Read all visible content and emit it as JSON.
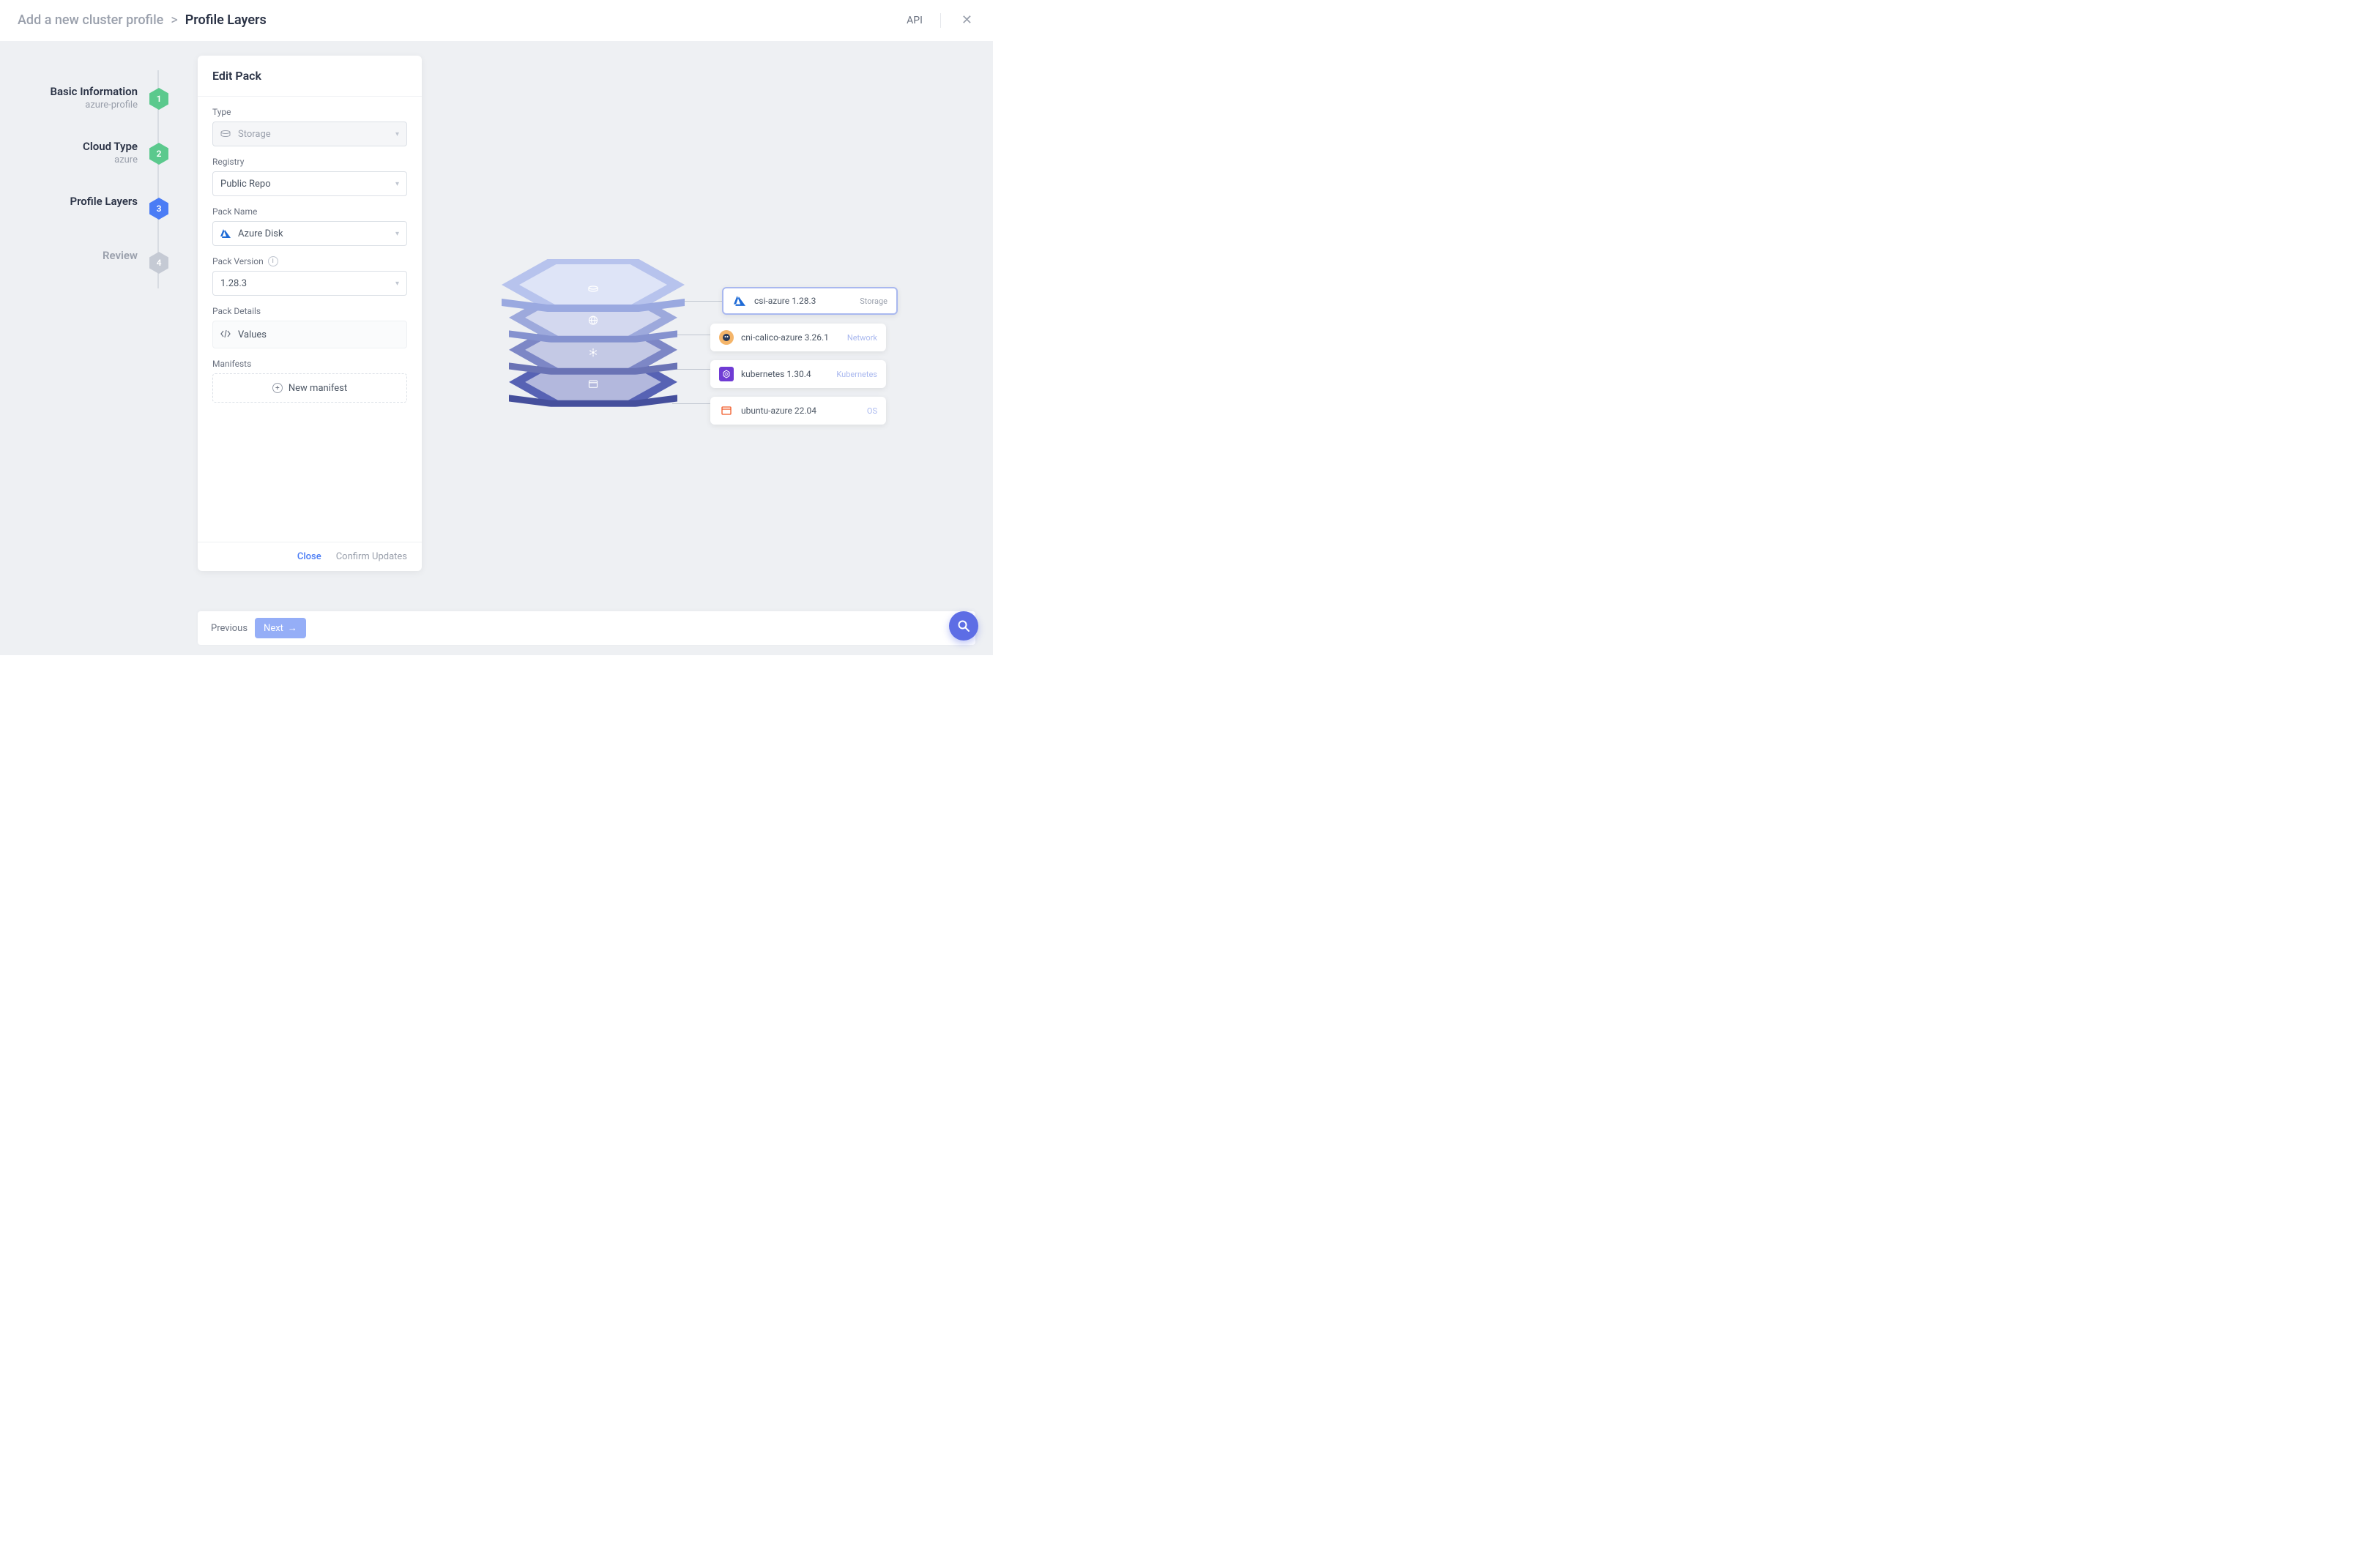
{
  "header": {
    "breadcrumb_prev": "Add a new cluster profile",
    "breadcrumb_sep": ">",
    "breadcrumb_current": "Profile Layers",
    "api_label": "API"
  },
  "steps": [
    {
      "num": "1",
      "title": "Basic Information",
      "sub": "azure-profile",
      "state": "done"
    },
    {
      "num": "2",
      "title": "Cloud Type",
      "sub": "azure",
      "state": "done"
    },
    {
      "num": "3",
      "title": "Profile Layers",
      "sub": "",
      "state": "active"
    },
    {
      "num": "4",
      "title": "Review",
      "sub": "",
      "state": "pending"
    }
  ],
  "panel": {
    "title": "Edit Pack",
    "fields": {
      "type": {
        "label": "Type",
        "value": "Storage"
      },
      "registry": {
        "label": "Registry",
        "value": "Public Repo"
      },
      "pack_name": {
        "label": "Pack Name",
        "value": "Azure Disk"
      },
      "pack_version": {
        "label": "Pack Version",
        "value": "1.28.3"
      },
      "pack_details": {
        "label": "Pack Details",
        "value": "Values"
      },
      "manifests": {
        "label": "Manifests",
        "button": "New manifest"
      }
    },
    "footer": {
      "close": "Close",
      "confirm": "Confirm Updates"
    }
  },
  "layers": [
    {
      "name": "csi-azure 1.28.3",
      "category": "Storage",
      "color": "#b7c3ed",
      "side": "#9aa9e0",
      "icon_bg": "#ffffff",
      "icon_color": "#1f6bd6"
    },
    {
      "name": "cni-calico-azure 3.26.1",
      "category": "Network",
      "color": "#9da9dc",
      "side": "#8592cf",
      "icon_bg": "#f4b56a",
      "icon_color": "#333"
    },
    {
      "name": "kubernetes 1.30.4",
      "category": "Kubernetes",
      "color": "#7d87c6",
      "side": "#6a73b5",
      "icon_bg": "#6f3bd4",
      "icon_color": "#fff"
    },
    {
      "name": "ubuntu-azure 22.04",
      "category": "OS",
      "color": "#5762b4",
      "side": "#454f9c",
      "icon_bg": "#ffffff",
      "icon_color": "#f05b28"
    }
  ],
  "footer": {
    "previous": "Previous",
    "next": "Next"
  }
}
